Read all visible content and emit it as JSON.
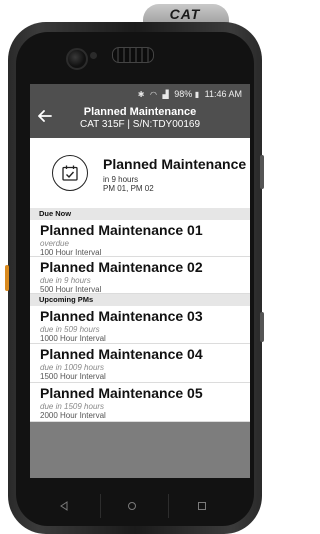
{
  "device": {
    "brand": "CAT"
  },
  "status_bar": {
    "battery": "98%",
    "time": "11:46 AM"
  },
  "app_bar": {
    "title": "Planned Maintenance",
    "subtitle": "CAT 315F | S/N:TDY00169"
  },
  "header": {
    "title": "Planned Maintenance",
    "line1": "in 9 hours",
    "line2": "PM 01, PM 02",
    "icon": "calendar-check-icon"
  },
  "sections": {
    "due_now": "Due Now",
    "upcoming": "Upcoming PMs"
  },
  "items": [
    {
      "name": "Planned Maintenance 01",
      "status": "overdue",
      "interval": "100 Hour Interval"
    },
    {
      "name": "Planned Maintenance 02",
      "status": "due in 9 hours",
      "interval": "500 Hour Interval"
    },
    {
      "name": "Planned Maintenance 03",
      "status": "due in 509 hours",
      "interval": "1000 Hour Interval"
    },
    {
      "name": "Planned Maintenance 04",
      "status": "due in 1009 hours",
      "interval": "1500 Hour Interval"
    },
    {
      "name": "Planned Maintenance 05",
      "status": "due in 1509 hours",
      "interval": "2000 Hour Interval"
    }
  ],
  "colors": {
    "app_bar": "#4f4f4f",
    "section_header": "#e6e6e6",
    "accent_button": "#d98a1e"
  }
}
